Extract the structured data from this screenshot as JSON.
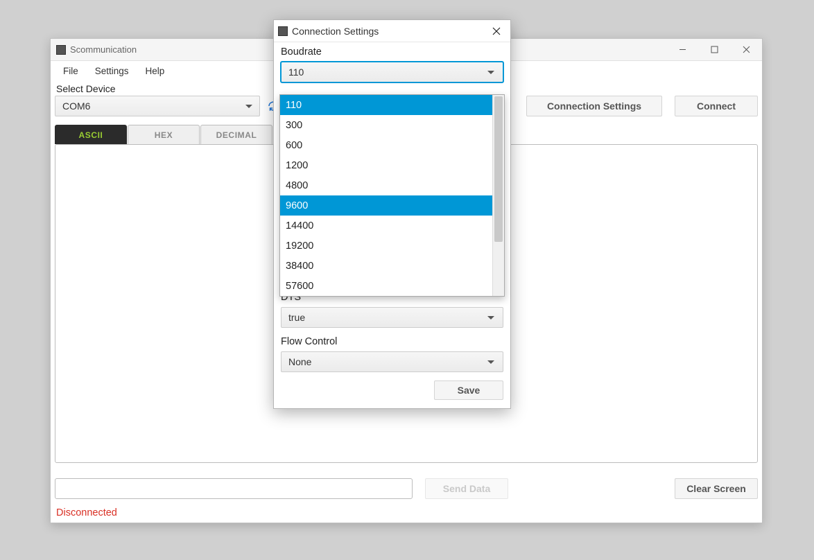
{
  "main": {
    "title": "Scommunication",
    "menu": {
      "file": "File",
      "settings": "Settings",
      "help": "Help"
    },
    "select_device_label": "Select Device",
    "device_value": "COM6",
    "btn_conn_settings": "Connection Settings",
    "btn_connect": "Connect",
    "tabs": {
      "ascii": "ASCII",
      "hex": "HEX",
      "decimal": "DECIMAL"
    },
    "btn_send": "Send Data",
    "btn_clear": "Clear Screen",
    "status": "Disconnected"
  },
  "dialog": {
    "title": "Connection Settings",
    "baudrate_label": "Boudrate",
    "baudrate_value": "110",
    "baudrate_options": [
      "110",
      "300",
      "600",
      "1200",
      "4800",
      "9600",
      "14400",
      "19200",
      "38400",
      "57600"
    ],
    "dts_label": "DTS",
    "dts_value": "true",
    "flow_label": "Flow Control",
    "flow_value": "None",
    "save": "Save"
  }
}
